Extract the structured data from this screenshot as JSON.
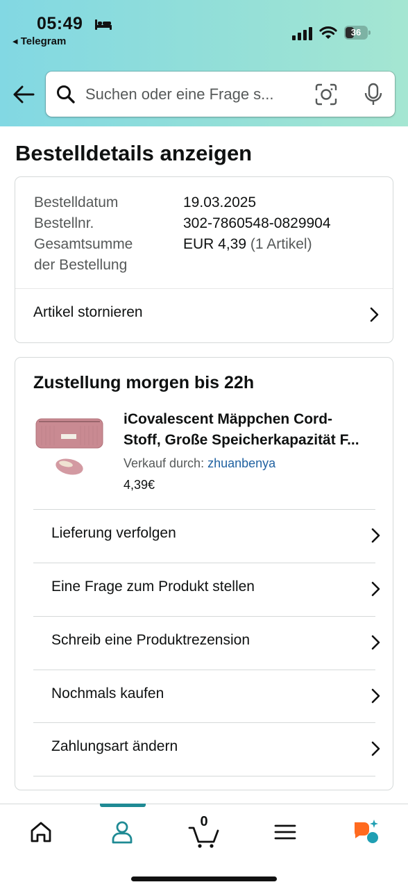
{
  "status_bar": {
    "time": "05:49",
    "back_app": "◂ Telegram",
    "battery": "36"
  },
  "search": {
    "placeholder": "Suchen oder eine Frage s..."
  },
  "page": {
    "title": "Bestelldetails anzeigen"
  },
  "order": {
    "date_label": "Bestelldatum",
    "date_value": "19.03.2025",
    "number_label": "Bestellnr.",
    "number_value": "302-7860548-0829904",
    "total_label_line1": "Gesamtsumme",
    "total_label_line2": "der Bestellung",
    "total_value": "EUR 4,39",
    "total_items": "(1 Artikel)",
    "cancel_label": "Artikel stornieren"
  },
  "delivery": {
    "title": "Zustellung morgen bis 22h",
    "product": {
      "title_line1": "iCovalescent Mäppchen Cord-",
      "title_line2": "Stoff, Große Speicherkapazität F...",
      "seller_prefix": "Verkauf durch: ",
      "seller_name": "zhuanbenya",
      "price": "4,39€",
      "image_icon": "pencil-case-image"
    },
    "actions": [
      {
        "label": "Lieferung verfolgen"
      },
      {
        "label": "Eine Frage zum Produkt stellen"
      },
      {
        "label": "Schreib eine Produktrezension"
      },
      {
        "label": "Nochmals kaufen"
      },
      {
        "label": "Zahlungsart ändern"
      }
    ]
  },
  "bottom_nav": {
    "items": [
      "home-icon",
      "account-icon",
      "cart-icon",
      "menu-icon",
      "rufus-icon"
    ],
    "cart_count": "0",
    "active_item": "account-icon",
    "accent_color": "#1f8a94"
  },
  "colors": {
    "header_gradient_start": "#82d8e3",
    "header_gradient_end": "#a5e6d2",
    "link": "#2162a1",
    "rufus_orange": "#ff6a1f",
    "rufus_teal": "#1f9fb3"
  }
}
